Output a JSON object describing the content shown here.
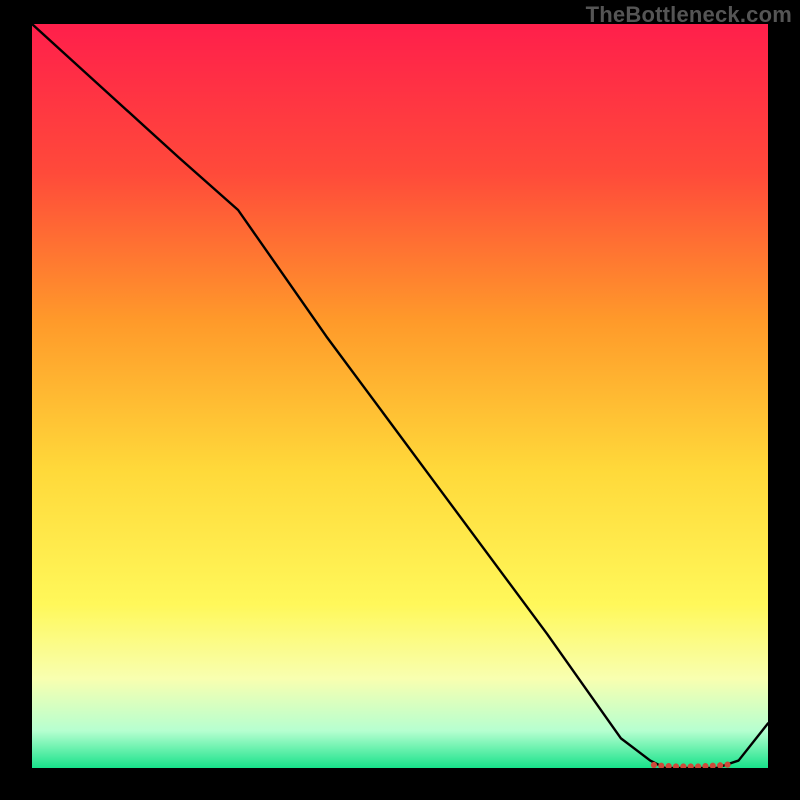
{
  "watermark": "TheBottleneck.com",
  "chart_data": {
    "type": "line",
    "title": "",
    "xlabel": "",
    "ylabel": "",
    "xlim": [
      0,
      100
    ],
    "ylim": [
      0,
      100
    ],
    "grid": false,
    "legend": false,
    "gradient_stops": [
      {
        "offset": 0,
        "color": "#ff1f4b"
      },
      {
        "offset": 20,
        "color": "#ff4a3a"
      },
      {
        "offset": 40,
        "color": "#ff9a2a"
      },
      {
        "offset": 60,
        "color": "#ffd93a"
      },
      {
        "offset": 78,
        "color": "#fff85a"
      },
      {
        "offset": 88,
        "color": "#f8ffb0"
      },
      {
        "offset": 95,
        "color": "#b6ffd0"
      },
      {
        "offset": 100,
        "color": "#18e28a"
      }
    ],
    "series": [
      {
        "name": "curve",
        "x": [
          0,
          10,
          20,
          28,
          40,
          55,
          70,
          80,
          84,
          86,
          90,
          93,
          96,
          100
        ],
        "y": [
          100,
          91,
          82,
          75,
          58,
          38,
          18,
          4,
          1,
          0,
          0,
          0,
          1,
          6
        ]
      }
    ],
    "markers": {
      "name": "flat-segment-dots",
      "color": "#ce4a3a",
      "x": [
        84.5,
        85.5,
        86.5,
        87.5,
        88.5,
        89.5,
        90.5,
        91.5,
        92.5,
        93.5,
        94.5
      ],
      "y": [
        0.4,
        0.3,
        0.25,
        0.2,
        0.2,
        0.2,
        0.2,
        0.25,
        0.3,
        0.35,
        0.45
      ]
    }
  }
}
